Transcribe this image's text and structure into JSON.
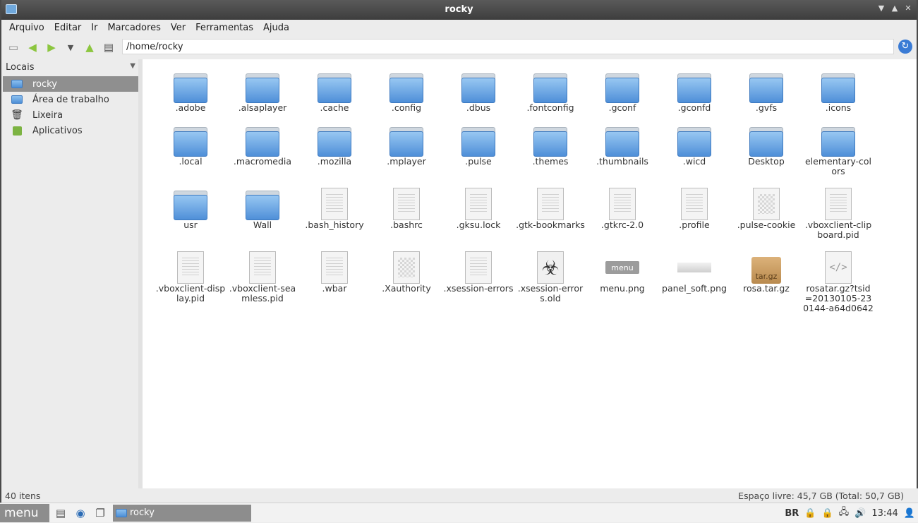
{
  "window": {
    "title": "rocky"
  },
  "menu": [
    "Arquivo",
    "Editar",
    "Ir",
    "Marcadores",
    "Ver",
    "Ferramentas",
    "Ajuda"
  ],
  "location": {
    "path": "/home/rocky"
  },
  "sidebar": {
    "header": "Locais",
    "items": [
      {
        "label": "rocky",
        "icon": "home-folder-icon",
        "selected": true
      },
      {
        "label": "Área de trabalho",
        "icon": "desktop-folder-icon",
        "selected": false
      },
      {
        "label": "Lixeira",
        "icon": "trash-icon",
        "selected": false
      },
      {
        "label": "Aplicativos",
        "icon": "applications-icon",
        "selected": false
      }
    ]
  },
  "files": [
    {
      "name": ".adobe",
      "type": "folder"
    },
    {
      "name": ".alsaplayer",
      "type": "folder"
    },
    {
      "name": ".cache",
      "type": "folder"
    },
    {
      "name": ".config",
      "type": "folder"
    },
    {
      "name": ".dbus",
      "type": "folder"
    },
    {
      "name": ".fontconfig",
      "type": "folder"
    },
    {
      "name": ".gconf",
      "type": "folder"
    },
    {
      "name": ".gconfd",
      "type": "folder"
    },
    {
      "name": ".gvfs",
      "type": "folder"
    },
    {
      "name": ".icons",
      "type": "folder"
    },
    {
      "name": ".local",
      "type": "folder"
    },
    {
      "name": ".macromedia",
      "type": "folder"
    },
    {
      "name": ".mozilla",
      "type": "folder"
    },
    {
      "name": ".mplayer",
      "type": "folder"
    },
    {
      "name": ".pulse",
      "type": "folder"
    },
    {
      "name": ".themes",
      "type": "folder"
    },
    {
      "name": ".thumbnails",
      "type": "folder"
    },
    {
      "name": ".wicd",
      "type": "folder"
    },
    {
      "name": "Desktop",
      "type": "folder"
    },
    {
      "name": "elementary-colors",
      "type": "folder"
    },
    {
      "name": "usr",
      "type": "folder"
    },
    {
      "name": "Wall",
      "type": "folder"
    },
    {
      "name": ".bash_history",
      "type": "text"
    },
    {
      "name": ".bashrc",
      "type": "text"
    },
    {
      "name": ".gksu.lock",
      "type": "text"
    },
    {
      "name": ".gtk-bookmarks",
      "type": "text"
    },
    {
      "name": ".gtkrc-2.0",
      "type": "text"
    },
    {
      "name": ".profile",
      "type": "text"
    },
    {
      "name": ".pulse-cookie",
      "type": "binary"
    },
    {
      "name": ".vboxclient-clipboard.pid",
      "type": "text"
    },
    {
      "name": ".vboxclient-display.pid",
      "type": "text"
    },
    {
      "name": ".vboxclient-seamless.pid",
      "type": "text"
    },
    {
      "name": ".wbar",
      "type": "text"
    },
    {
      "name": ".Xauthority",
      "type": "binary"
    },
    {
      "name": ".xsession-errors",
      "type": "text"
    },
    {
      "name": ".xsession-errors.old",
      "type": "hazard"
    },
    {
      "name": "menu.png",
      "type": "menu-image"
    },
    {
      "name": "panel_soft.png",
      "type": "panel-image"
    },
    {
      "name": "rosa.tar.gz",
      "type": "archive"
    },
    {
      "name": "rosatar.gz?tsid=20130105-230144-a64d0642",
      "type": "code"
    }
  ],
  "status": {
    "count": "40 itens",
    "free": "Espaço livre: 45,7 GB (Total: 50,7 GB)"
  },
  "panel": {
    "start_label": "menu",
    "task_label": "rocky",
    "keyboard": "BR",
    "clock": "13:44"
  },
  "icon_labels": {
    "archive": "tar.gz",
    "menu_image": "menu",
    "hazard": "☣",
    "code": "</>"
  },
  "colors": {
    "folder": "#4f8fd8",
    "selection": "#8f8f8f",
    "titlebar": "#3d3d3d"
  }
}
